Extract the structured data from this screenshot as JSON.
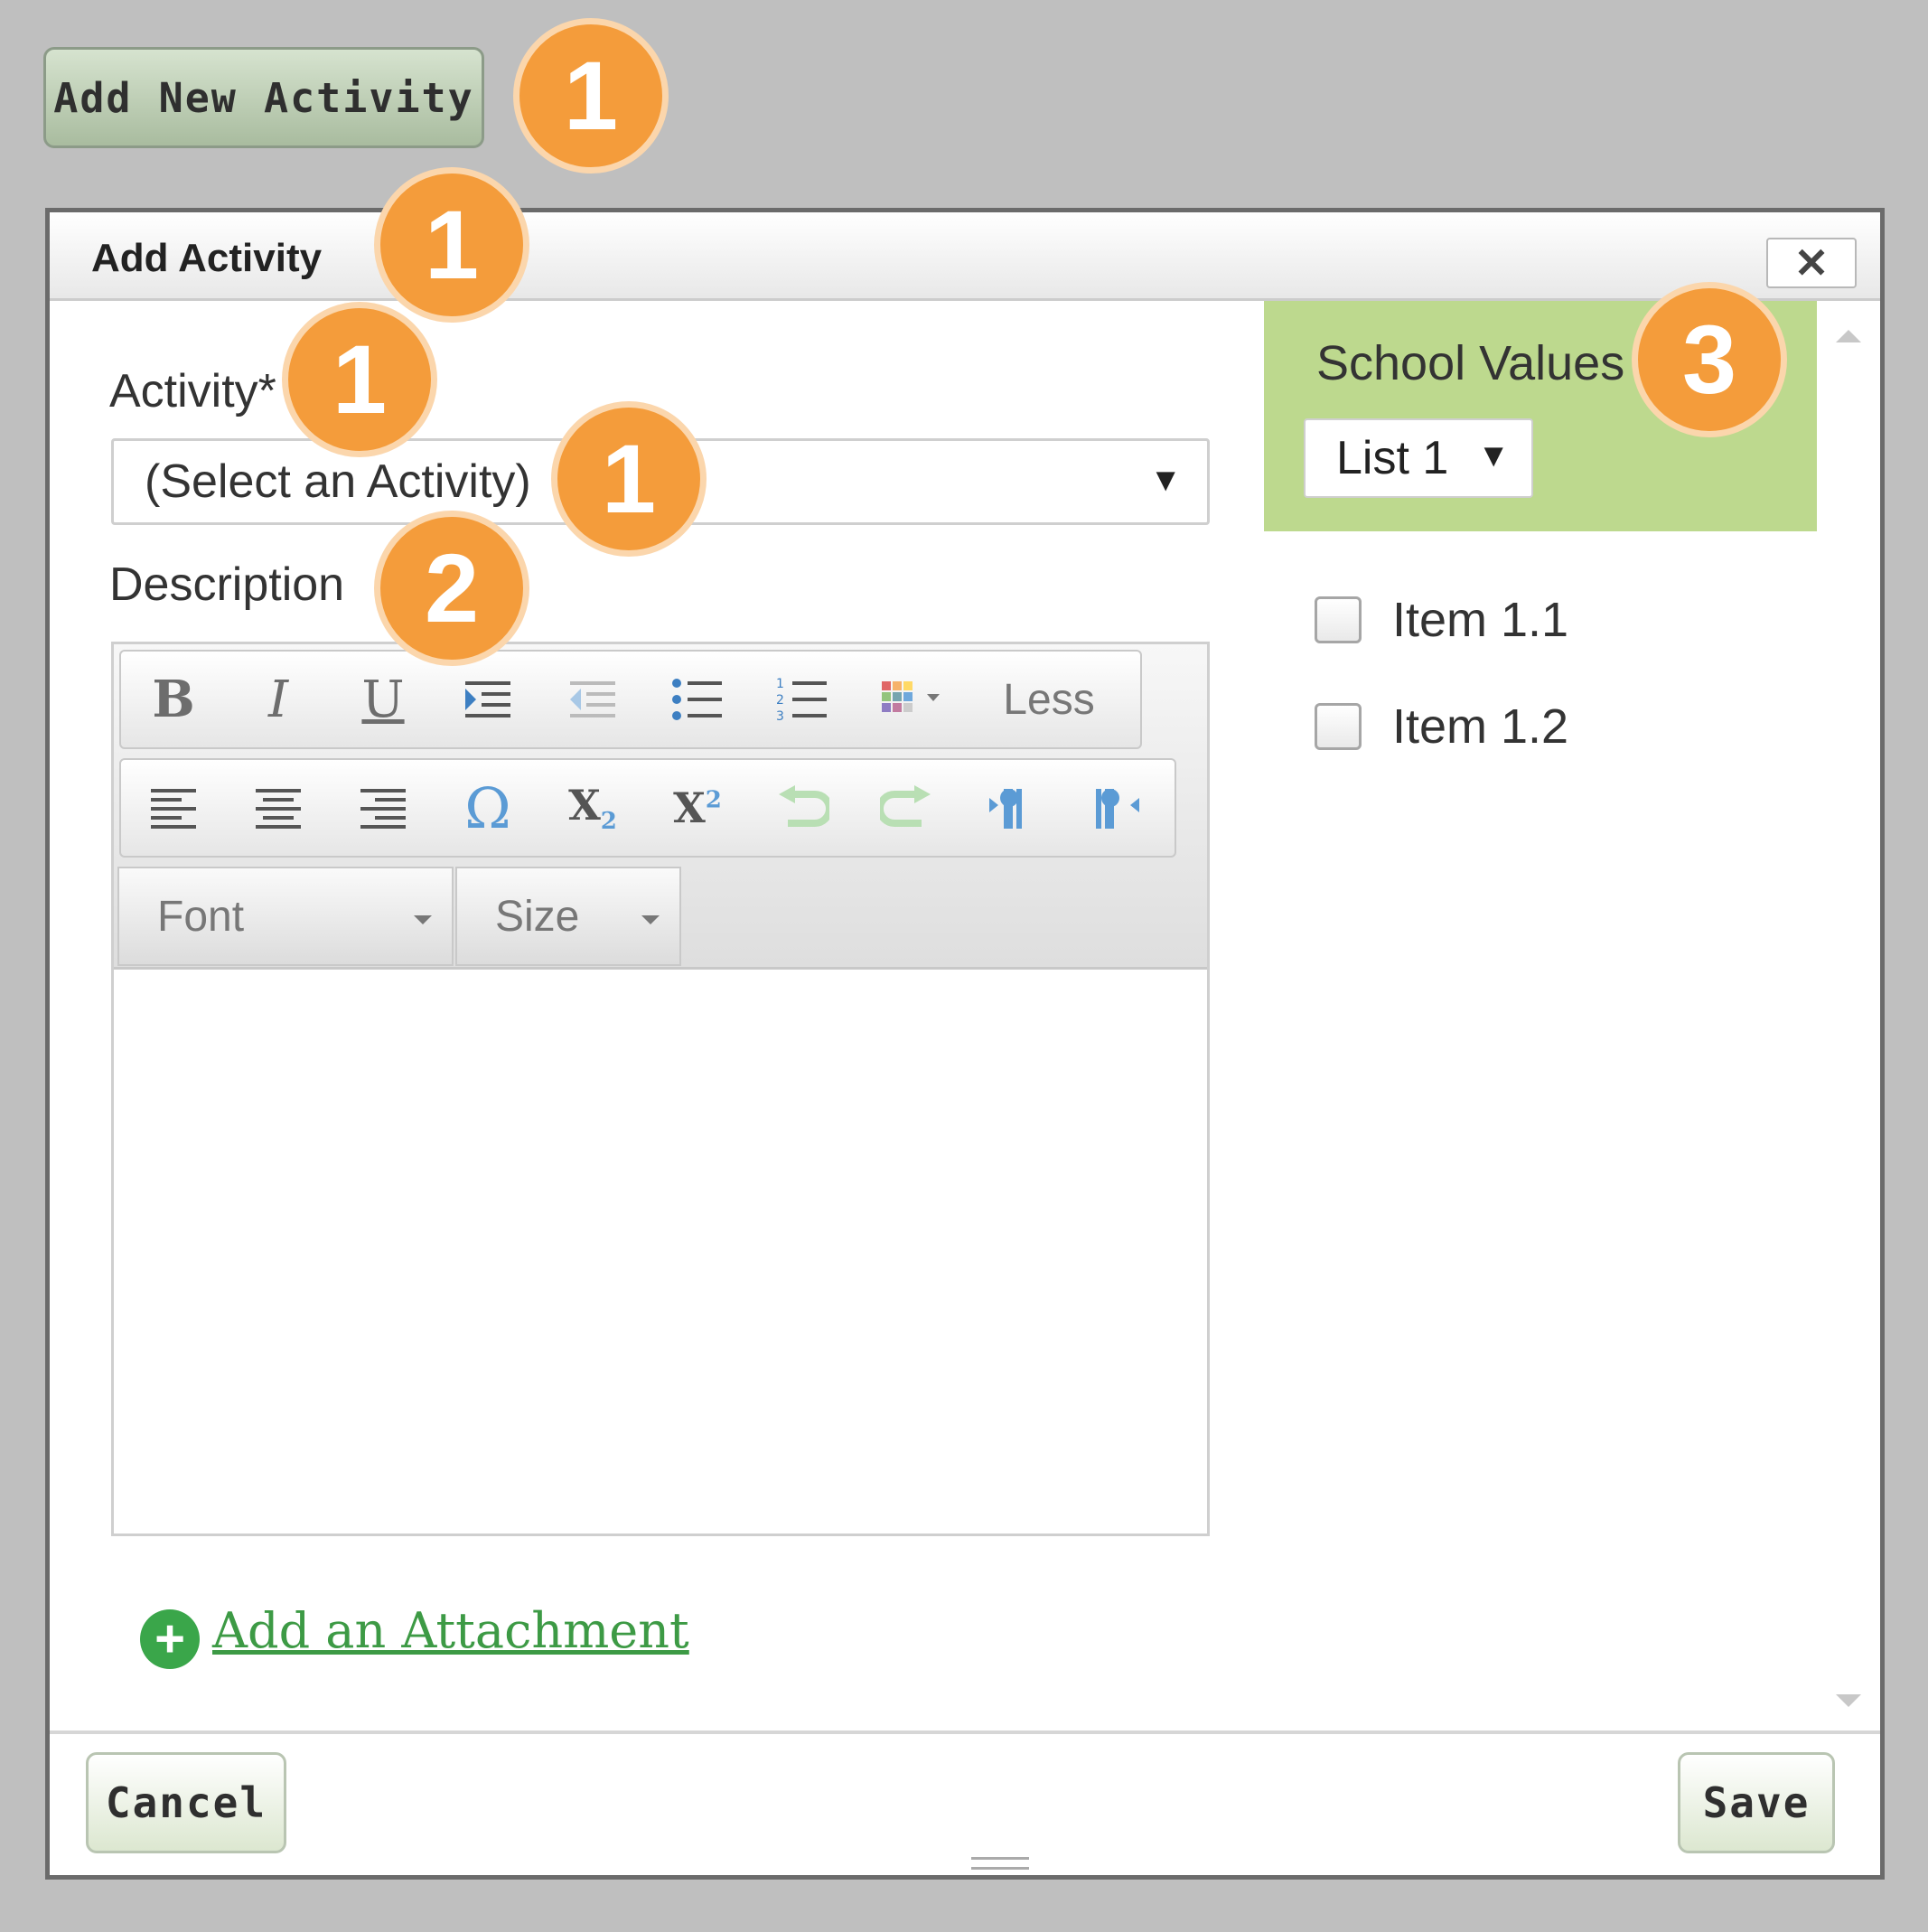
{
  "top": {
    "add_new_label": "Add New Activity"
  },
  "dialog": {
    "title": "Add Activity",
    "close_symbol": "✕",
    "activity_label": "Activity*",
    "activity_select_value": "(Select an Activity)",
    "description_label": "Description",
    "toolbar": {
      "row1": [
        "bold",
        "italic",
        "underline",
        "indent",
        "outdent",
        "bulleted-list",
        "numbered-list",
        "color-grid"
      ],
      "less_label": "Less",
      "row2": [
        "align-left",
        "align-center",
        "align-right",
        "special-char",
        "subscript",
        "superscript",
        "undo",
        "redo",
        "ltr",
        "rtl"
      ],
      "font_label": "Font",
      "size_label": "Size"
    },
    "attachment_link": "Add an Attachment",
    "cancel_label": "Cancel",
    "save_label": "Save"
  },
  "values_panel": {
    "title": "School Values",
    "list_select_value": "List 1",
    "items": [
      "Item 1.1",
      "Item 1.2"
    ]
  },
  "callouts": [
    "1",
    "1",
    "1",
    "1",
    "2",
    "3"
  ],
  "colors": {
    "badge": "#f49c3b",
    "values_header": "#bdd98e",
    "link_green": "#3d9a45"
  }
}
